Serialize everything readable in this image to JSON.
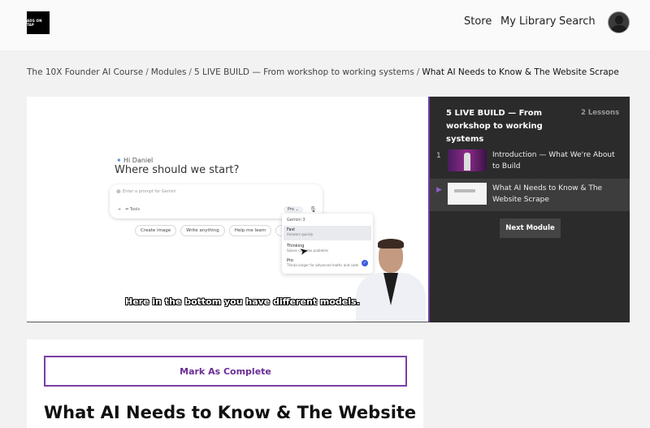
{
  "header": {
    "logo_text": "ADS ON TAP",
    "nav": {
      "store": "Store",
      "library": "My Library",
      "search": "Search"
    }
  },
  "breadcrumb": {
    "items": [
      "The 10X Founder AI Course",
      "Modules",
      "5 LIVE BUILD — From workshop to working systems"
    ],
    "separator": "/",
    "current": "What AI Needs to Know & The Website Scrape"
  },
  "video": {
    "greeting": "Hi Daniel",
    "question": "Where should we start?",
    "prompt_placeholder": "Enter a prompt for Gemini",
    "tools_label": "Tools",
    "model_button": "Pro",
    "chips": [
      "Create image",
      "Write anything",
      "Help me learn",
      "Boost my"
    ],
    "model_menu": {
      "title": "Gemini 3",
      "options": [
        {
          "name": "Fast",
          "desc": "Answers quickly"
        },
        {
          "name": "Thinking",
          "desc": "Solves complex problems"
        },
        {
          "name": "Pro",
          "desc": "Thinks longer for advanced maths and code"
        }
      ]
    },
    "caption": "Here in the bottom you have different models."
  },
  "sidebar": {
    "module_title": "5 LIVE BUILD — From workshop to working systems",
    "lesson_count": "2 Lessons",
    "lessons": [
      {
        "number": "1",
        "title": "Introduction — What We're About to Build"
      },
      {
        "number": "",
        "title": "What AI Needs to Know & The Website Scrape"
      }
    ],
    "next_module": "Next Module"
  },
  "content": {
    "mark_complete": "Mark As Complete",
    "lesson_heading": "What AI Needs to Know & The Website"
  },
  "colors": {
    "accent": "#7a3fa6",
    "sidebar_bg": "#2b2b2b"
  }
}
